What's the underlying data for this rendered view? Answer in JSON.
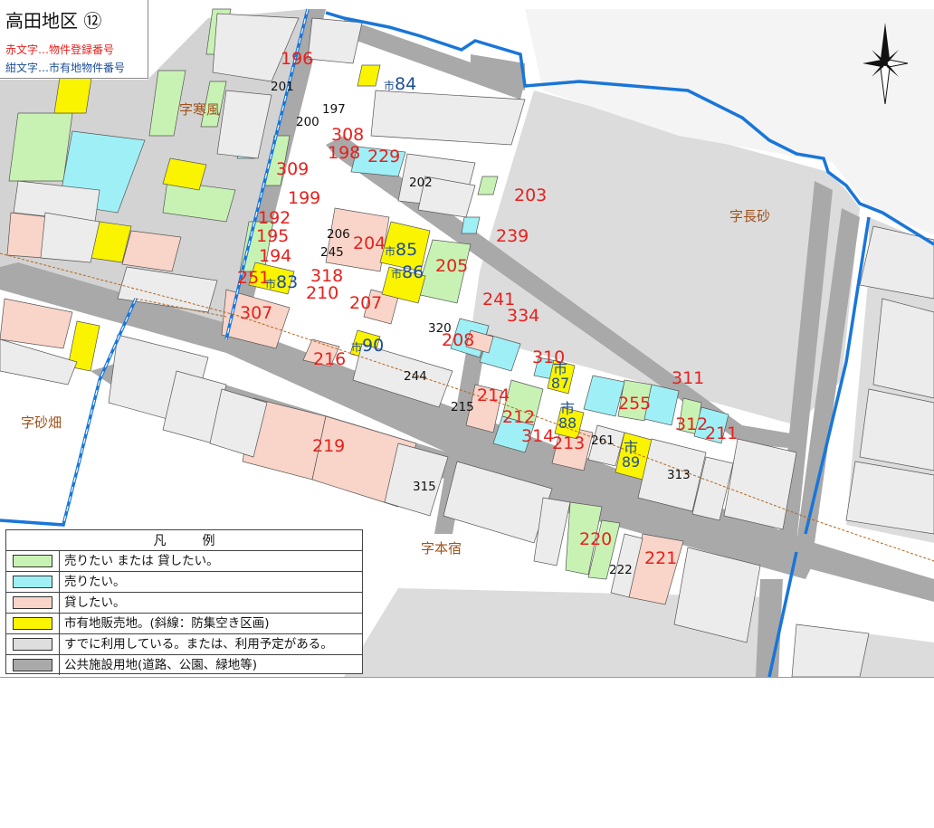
{
  "title": {
    "main": "高田地区 ⑫",
    "red_note": "赤文字…物件登録番号",
    "blue_note": "紺文字…市有地物件番号"
  },
  "colors": {
    "green": "#c8f2b4",
    "cyan": "#9ff0f6",
    "pink": "#f9d4c8",
    "yellow": "#fbf400",
    "gray": "#dedede",
    "darkgray": "#a9a9a9",
    "boundary": "#1976d9",
    "red_text": "#e8201c",
    "blue_text": "#1c4e96",
    "area_text": "#a0521c"
  },
  "legend": {
    "title_left": "凡",
    "title_right": "例",
    "items": [
      {
        "color": "#c8f2b4",
        "label": "売りたい または 貸したい。"
      },
      {
        "color": "#9ff0f6",
        "label": "売りたい。"
      },
      {
        "color": "#f9d4c8",
        "label": "貸したい。"
      },
      {
        "color": "#fbf400",
        "label": "市有地販売地。(斜線：防集空き区画)"
      },
      {
        "color": "#dedede",
        "label": "すでに利用している。または、利用予定がある。"
      },
      {
        "color": "#a9a9a9",
        "label": "公共施設用地(道路、公園、緑地等)"
      }
    ]
  },
  "area_names": [
    "字寒風",
    "字長砂",
    "字砂畑",
    "字本宿"
  ],
  "registered_numbers": [
    "196",
    "308",
    "198",
    "229",
    "309",
    "199",
    "203",
    "192",
    "195",
    "204",
    "239",
    "194",
    "251",
    "318",
    "205",
    "210",
    "241",
    "307",
    "207",
    "334",
    "208",
    "216",
    "310",
    "311",
    "214",
    "255",
    "212",
    "88",
    "312",
    "211",
    "314",
    "213",
    "219",
    "220",
    "221"
  ],
  "city_numbers": [
    "市84",
    "市85",
    "市86",
    "市83",
    "市90",
    "市87",
    "市88",
    "市89"
  ],
  "black_numbers": [
    "201",
    "197",
    "200",
    "202",
    "206",
    "245",
    "320",
    "244",
    "215",
    "261",
    "313",
    "315",
    "222"
  ]
}
